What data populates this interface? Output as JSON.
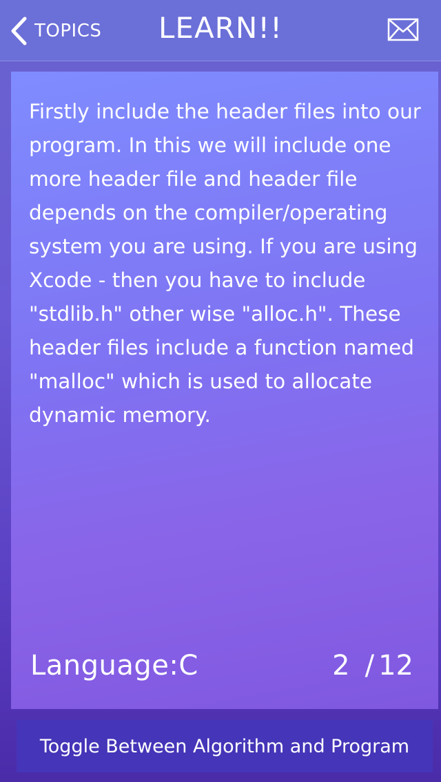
{
  "nav": {
    "back_label": "TOPICS",
    "title": "LEARN!!",
    "mail_icon": "mail-icon",
    "back_icon": "chevron-left-icon"
  },
  "content": {
    "text": "Firstly include the header files into our program. In this we will include one more header file and header file depends on the compiler/operating system you are using. If you are using Xcode - then you have to include \"stdlib.h\" other wise \"alloc.h\". These header files include a function named \"malloc\" which is used to allocate dynamic memory."
  },
  "footer": {
    "language_label": "Language:",
    "language_value": "C",
    "current": "2",
    "total": "12"
  },
  "toggle_button": {
    "label": "Toggle Between Algorithm and Program"
  },
  "colors": {
    "nav_bg": "#6b6fd8",
    "button_bg": "#4535b8"
  }
}
